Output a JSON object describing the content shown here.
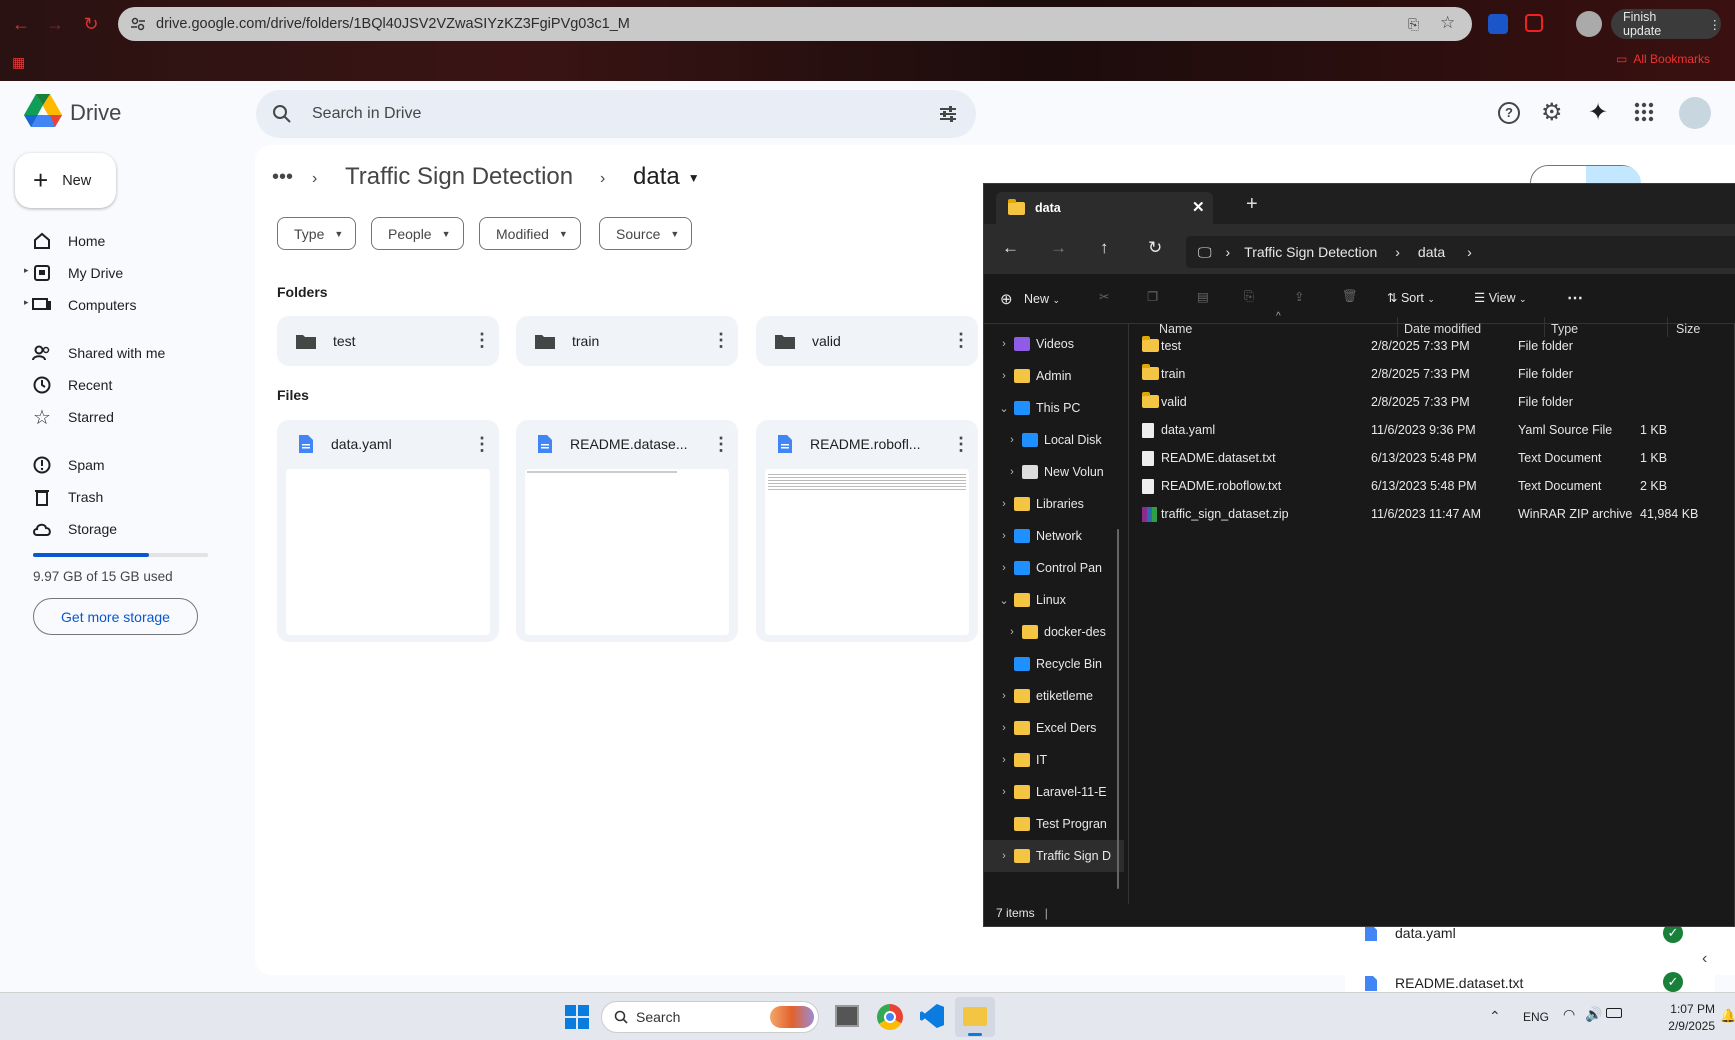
{
  "browser": {
    "url": "drive.google.com/drive/folders/1BQl40JSV2VZwaSIYzKZ3FgiPVg03c1_M",
    "finish_update": "Finish update",
    "all_bookmarks": "All Bookmarks"
  },
  "drive": {
    "logo_text": "Drive",
    "search_placeholder": "Search in Drive",
    "new_label": "New",
    "sidebar": [
      {
        "label": "Home",
        "icon": "home-icon"
      },
      {
        "label": "My Drive",
        "icon": "my-drive-icon"
      },
      {
        "label": "Computers",
        "icon": "computers-icon"
      },
      {
        "label": "Shared with me",
        "icon": "shared-icon"
      },
      {
        "label": "Recent",
        "icon": "clock-icon"
      },
      {
        "label": "Starred",
        "icon": "star-icon"
      },
      {
        "label": "Spam",
        "icon": "spam-icon"
      },
      {
        "label": "Trash",
        "icon": "trash-icon"
      },
      {
        "label": "Storage",
        "icon": "cloud-icon"
      }
    ],
    "storage_text": "9.97 GB of 15 GB used",
    "storage_fraction": 0.665,
    "get_more": "Get more storage",
    "breadcrumb": {
      "more": "•••",
      "parent": "Traffic Sign Detection",
      "current": "data"
    },
    "filters": [
      "Type",
      "People",
      "Modified",
      "Source"
    ],
    "folders_title": "Folders",
    "folders": [
      "test",
      "train",
      "valid"
    ],
    "files_title": "Files",
    "files": [
      "data.yaml",
      "README.datase...",
      "README.robofl..."
    ],
    "side_panel": [
      "data.yaml",
      "README.dataset.txt"
    ]
  },
  "explorer": {
    "tab_title": "data",
    "address": [
      "Traffic Sign Detection",
      "data"
    ],
    "toolbar": {
      "new": "New",
      "sort": "Sort",
      "view": "View"
    },
    "tree": [
      {
        "label": "Videos",
        "chev": "›"
      },
      {
        "label": "Admin",
        "chev": "›"
      },
      {
        "label": "This PC",
        "chev": "⌄"
      },
      {
        "label": "Local Disk",
        "chev": "›"
      },
      {
        "label": "New Volun",
        "chev": "›"
      },
      {
        "label": "Libraries",
        "chev": "›"
      },
      {
        "label": "Network",
        "chev": "›"
      },
      {
        "label": "Control Pan",
        "chev": "›"
      },
      {
        "label": "Linux",
        "chev": "⌄"
      },
      {
        "label": "docker-des",
        "chev": "›"
      },
      {
        "label": "Recycle Bin",
        "chev": ""
      },
      {
        "label": "etiketleme",
        "chev": "›"
      },
      {
        "label": "Excel Ders",
        "chev": "›"
      },
      {
        "label": "IT",
        "chev": "›"
      },
      {
        "label": "Laravel-11-E",
        "chev": "›"
      },
      {
        "label": "Test Progran",
        "chev": ""
      },
      {
        "label": "Traffic Sign D",
        "chev": "›"
      }
    ],
    "columns": {
      "name": "Name",
      "date": "Date modified",
      "type": "Type",
      "size": "Size"
    },
    "rows": [
      {
        "name": "test",
        "date": "2/8/2025 7:33 PM",
        "type": "File folder",
        "size": "",
        "kind": "folder"
      },
      {
        "name": "train",
        "date": "2/8/2025 7:33 PM",
        "type": "File folder",
        "size": "",
        "kind": "folder"
      },
      {
        "name": "valid",
        "date": "2/8/2025 7:33 PM",
        "type": "File folder",
        "size": "",
        "kind": "folder"
      },
      {
        "name": "data.yaml",
        "date": "11/6/2023 9:36 PM",
        "type": "Yaml Source File",
        "size": "1 KB",
        "kind": "doc"
      },
      {
        "name": "README.dataset.txt",
        "date": "6/13/2023 5:48 PM",
        "type": "Text Document",
        "size": "1 KB",
        "kind": "doc"
      },
      {
        "name": "README.roboflow.txt",
        "date": "6/13/2023 5:48 PM",
        "type": "Text Document",
        "size": "2 KB",
        "kind": "doc"
      },
      {
        "name": "traffic_sign_dataset.zip",
        "date": "11/6/2023 11:47 AM",
        "type": "WinRAR ZIP archive",
        "size": "41,984 KB",
        "kind": "zip"
      }
    ],
    "status": "7 items"
  },
  "taskbar": {
    "search": "Search",
    "lang": "ENG",
    "time": "1:07 PM",
    "date": "2/9/2025"
  }
}
